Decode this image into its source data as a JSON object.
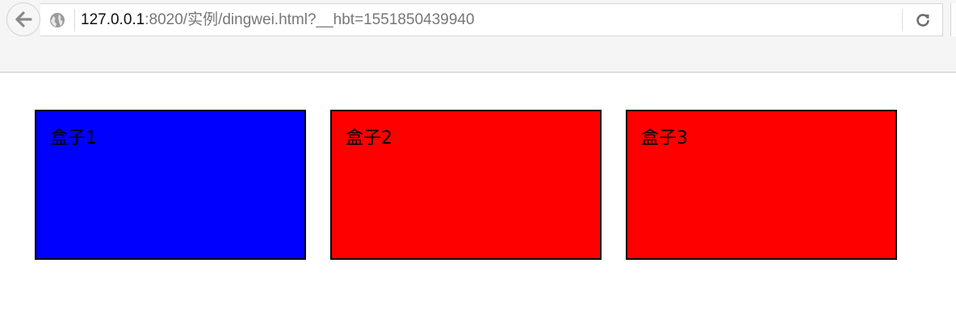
{
  "browser": {
    "url_host": "127.0.0.1",
    "url_rest": ":8020/实例/dingwei.html?__hbt=1551850439940",
    "icons": {
      "back": "back-arrow-icon",
      "site": "globe-icon",
      "reload": "reload-icon"
    }
  },
  "page": {
    "boxes": [
      {
        "label": "盒子1",
        "color": "#0000ff"
      },
      {
        "label": "盒子2",
        "color": "#ff0000"
      },
      {
        "label": "盒子3",
        "color": "#ff0000"
      }
    ]
  }
}
